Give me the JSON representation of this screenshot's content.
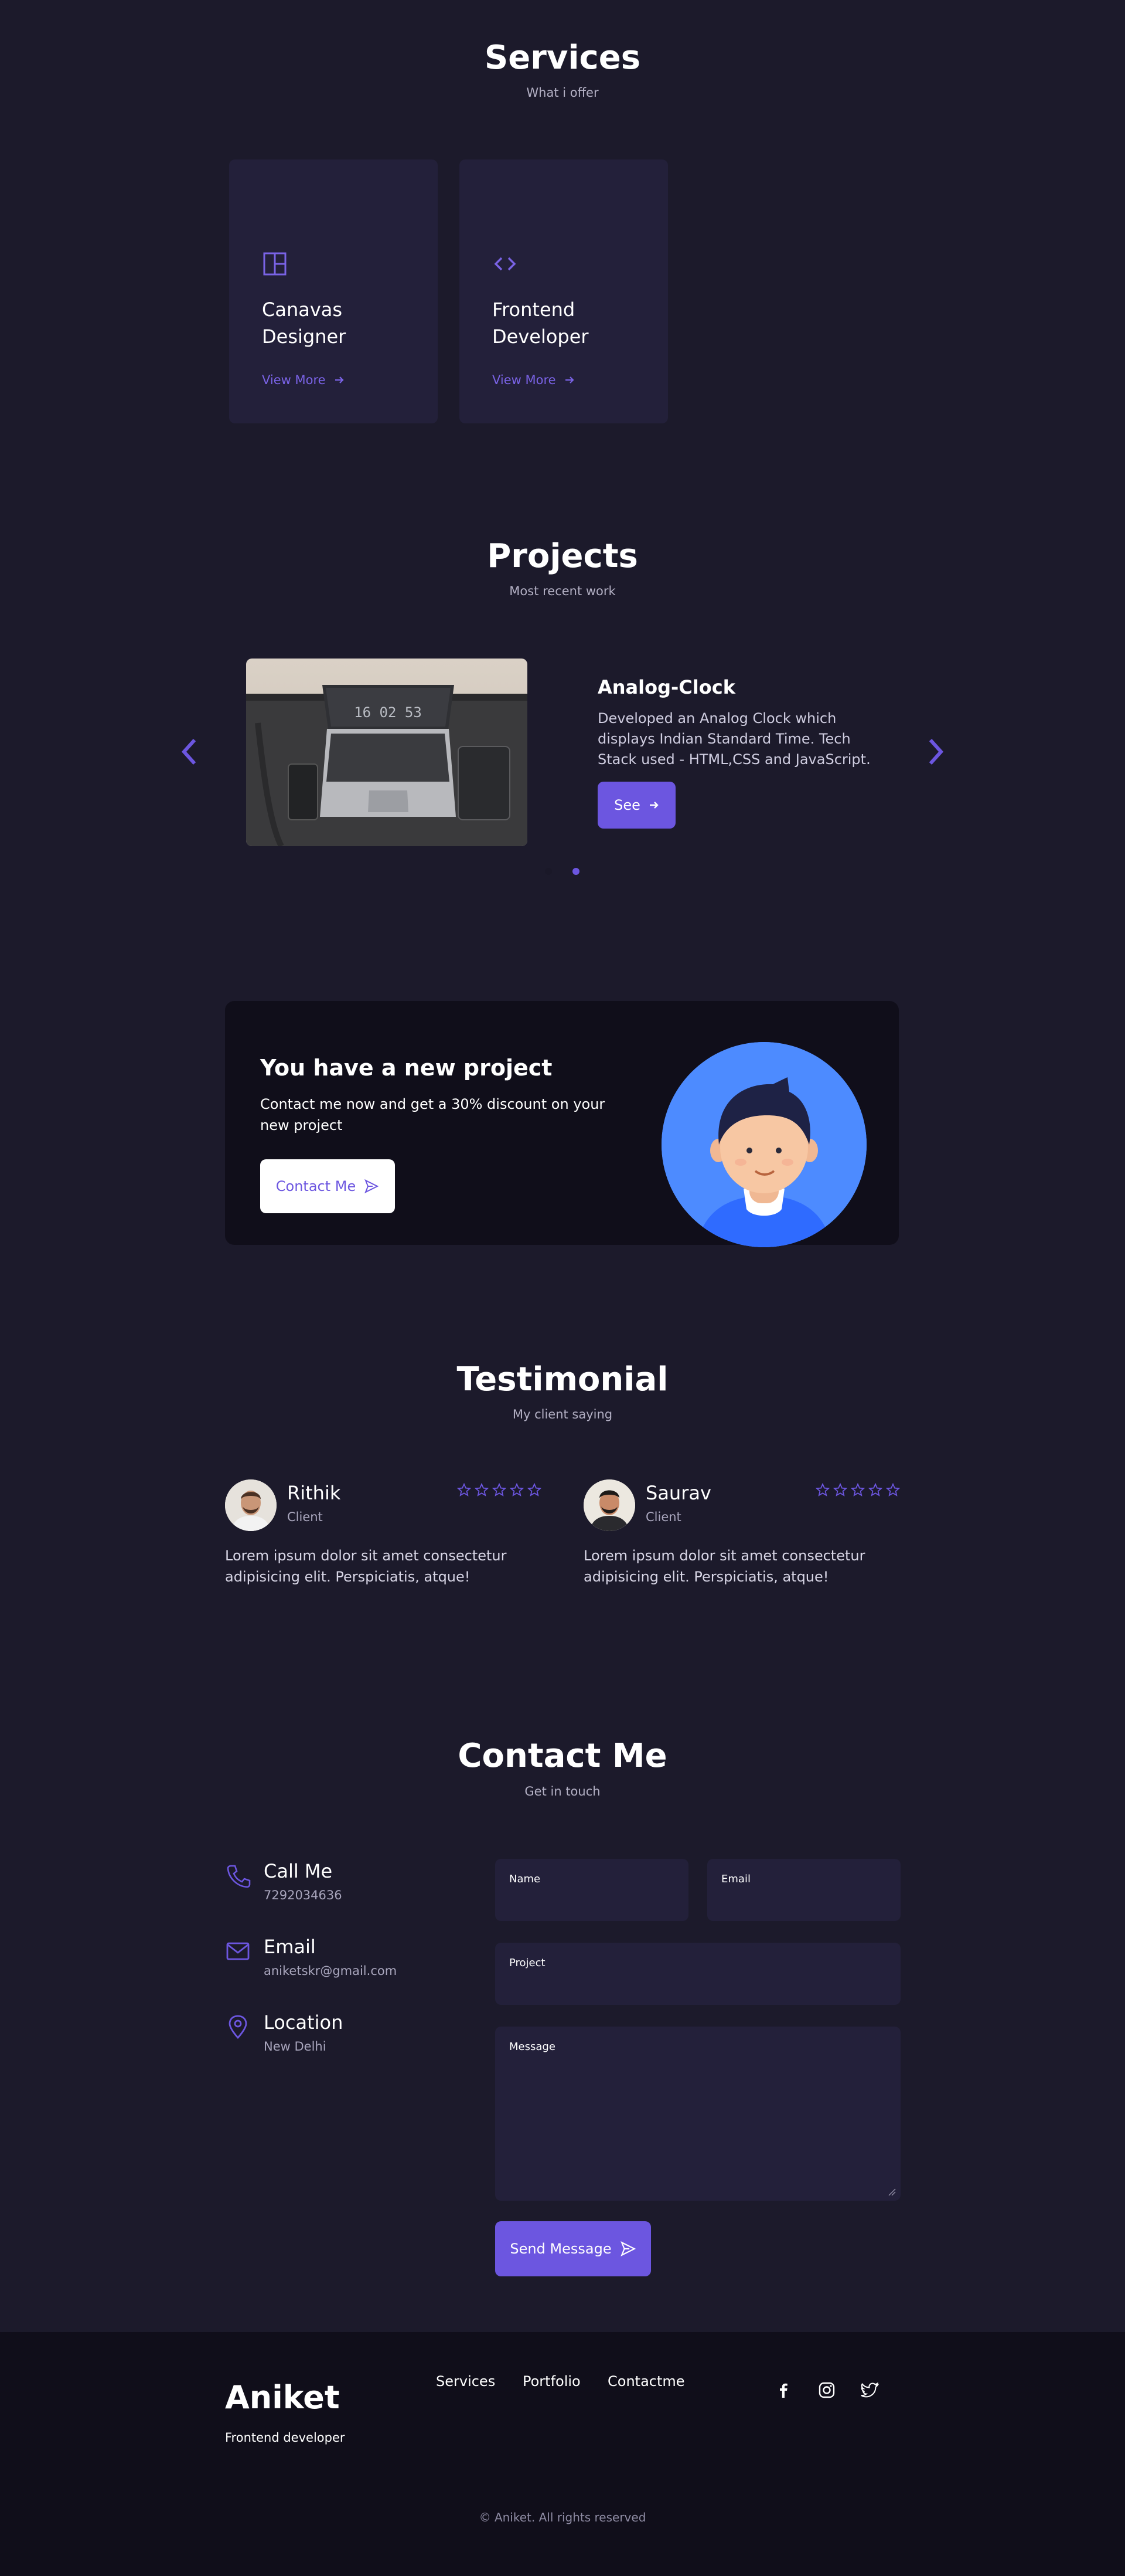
{
  "colors": {
    "background": "#1c1a2b",
    "card": "#23203a",
    "accent": "#6c56e0",
    "footer": "#100e1a"
  },
  "services": {
    "title": "Services",
    "subtitle": "What i offer",
    "cards": [
      {
        "title": "Canavas Designer",
        "link": "View More",
        "icon": "layout-icon"
      },
      {
        "title": "Frontend Developer",
        "link": "View More",
        "icon": "code-icon"
      }
    ]
  },
  "projects": {
    "title": "Projects",
    "subtitle": "Most recent work",
    "item": {
      "title": "Analog-Clock",
      "description": "Developed an Analog Clock which displays Indian Standard Time. Tech Stack used - HTML,CSS and JavaScript.",
      "button": "See",
      "screen_time": "16 02 53"
    },
    "slides_total": 2,
    "active_slide": 2
  },
  "promo": {
    "title": "You have a new project",
    "text": "Contact me now and get a 30% discount on your new project",
    "button": "Contact Me"
  },
  "testimonial": {
    "title": "Testimonial",
    "subtitle": "My client saying",
    "items": [
      {
        "name": "Rithik",
        "role": "Client",
        "stars": 5,
        "quote": "Lorem ipsum dolor sit amet consectetur adipisicing elit. Perspiciatis, atque!"
      },
      {
        "name": "Saurav",
        "role": "Client",
        "stars": 5,
        "quote": "Lorem ipsum dolor sit amet consectetur adipisicing elit. Perspiciatis, atque!"
      }
    ]
  },
  "contact": {
    "title": "Contact Me",
    "subtitle": "Get in touch",
    "info": [
      {
        "label": "Call Me",
        "value": "7292034636",
        "icon": "phone-icon"
      },
      {
        "label": "Email",
        "value": "aniketskr@gmail.com",
        "icon": "mail-icon"
      },
      {
        "label": "Location",
        "value": "New Delhi",
        "icon": "location-icon"
      }
    ],
    "form": {
      "name_label": "Name",
      "email_label": "Email",
      "project_label": "Project",
      "message_label": "Message",
      "submit": "Send Message"
    }
  },
  "footer": {
    "brand": "Aniket",
    "role": "Frontend developer",
    "links": [
      "Services",
      "Portfolio",
      "Contactme"
    ],
    "social": [
      "facebook-icon",
      "instagram-icon",
      "twitter-icon"
    ],
    "copyright": "© Aniket. All rights reserved"
  }
}
